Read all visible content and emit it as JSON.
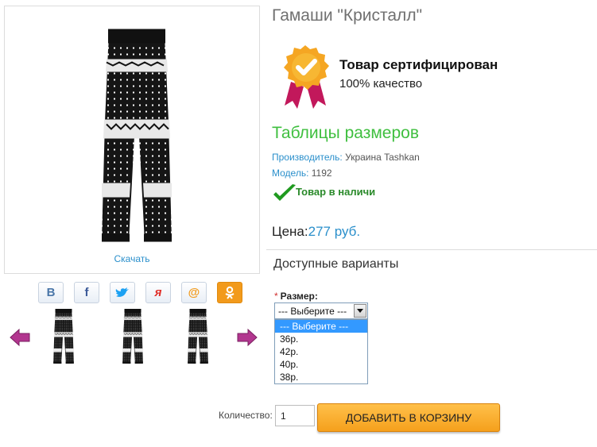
{
  "product": {
    "title": "Гамаши \"Кристалл\"",
    "zoom_label": "Скачать",
    "certified_title": "Товар сертифицирован",
    "certified_sub": "100% качество",
    "size_table_link": "Таблицы размеров",
    "manufacturer_label": "Производитель:",
    "manufacturer_value": "Украина Tashkan",
    "model_label": "Модель:",
    "model_value": "1192",
    "stock_status": "Товар в наличи",
    "price_label": "Цена:",
    "price_value": "277 руб."
  },
  "share": {
    "buttons": [
      {
        "label": "В",
        "icon": "vkontakte-icon",
        "color": "#4a76a8"
      },
      {
        "label": "f",
        "icon": "facebook-icon",
        "color": "#3b5998"
      },
      {
        "label": "",
        "icon": "twitter-icon",
        "color": "#1da1f2"
      },
      {
        "label": "я",
        "icon": "yaru-icon",
        "color": "#e0302a"
      },
      {
        "label": "@",
        "icon": "mailru-icon",
        "color": "#f29a1b"
      },
      {
        "label": "ок",
        "icon": "odnoklassniki-icon",
        "color": "#f29a1b"
      }
    ]
  },
  "options": {
    "heading": "Доступные варианты",
    "size_label": "Размер:",
    "required_mark": "*",
    "selected": "--- Выберите ---",
    "items": [
      "--- Выберите ---",
      "36р.",
      "42р.",
      "40р.",
      "38р."
    ]
  },
  "cart": {
    "quantity_label": "Количество:",
    "quantity_value": "1",
    "add_button": "ДОБАВИТЬ В КОРЗИНУ"
  },
  "colors": {
    "link_blue": "#2a8fcb",
    "green": "#3fbf3f",
    "orange": "#f5a01c",
    "arrow_purple": "#b2368f"
  }
}
